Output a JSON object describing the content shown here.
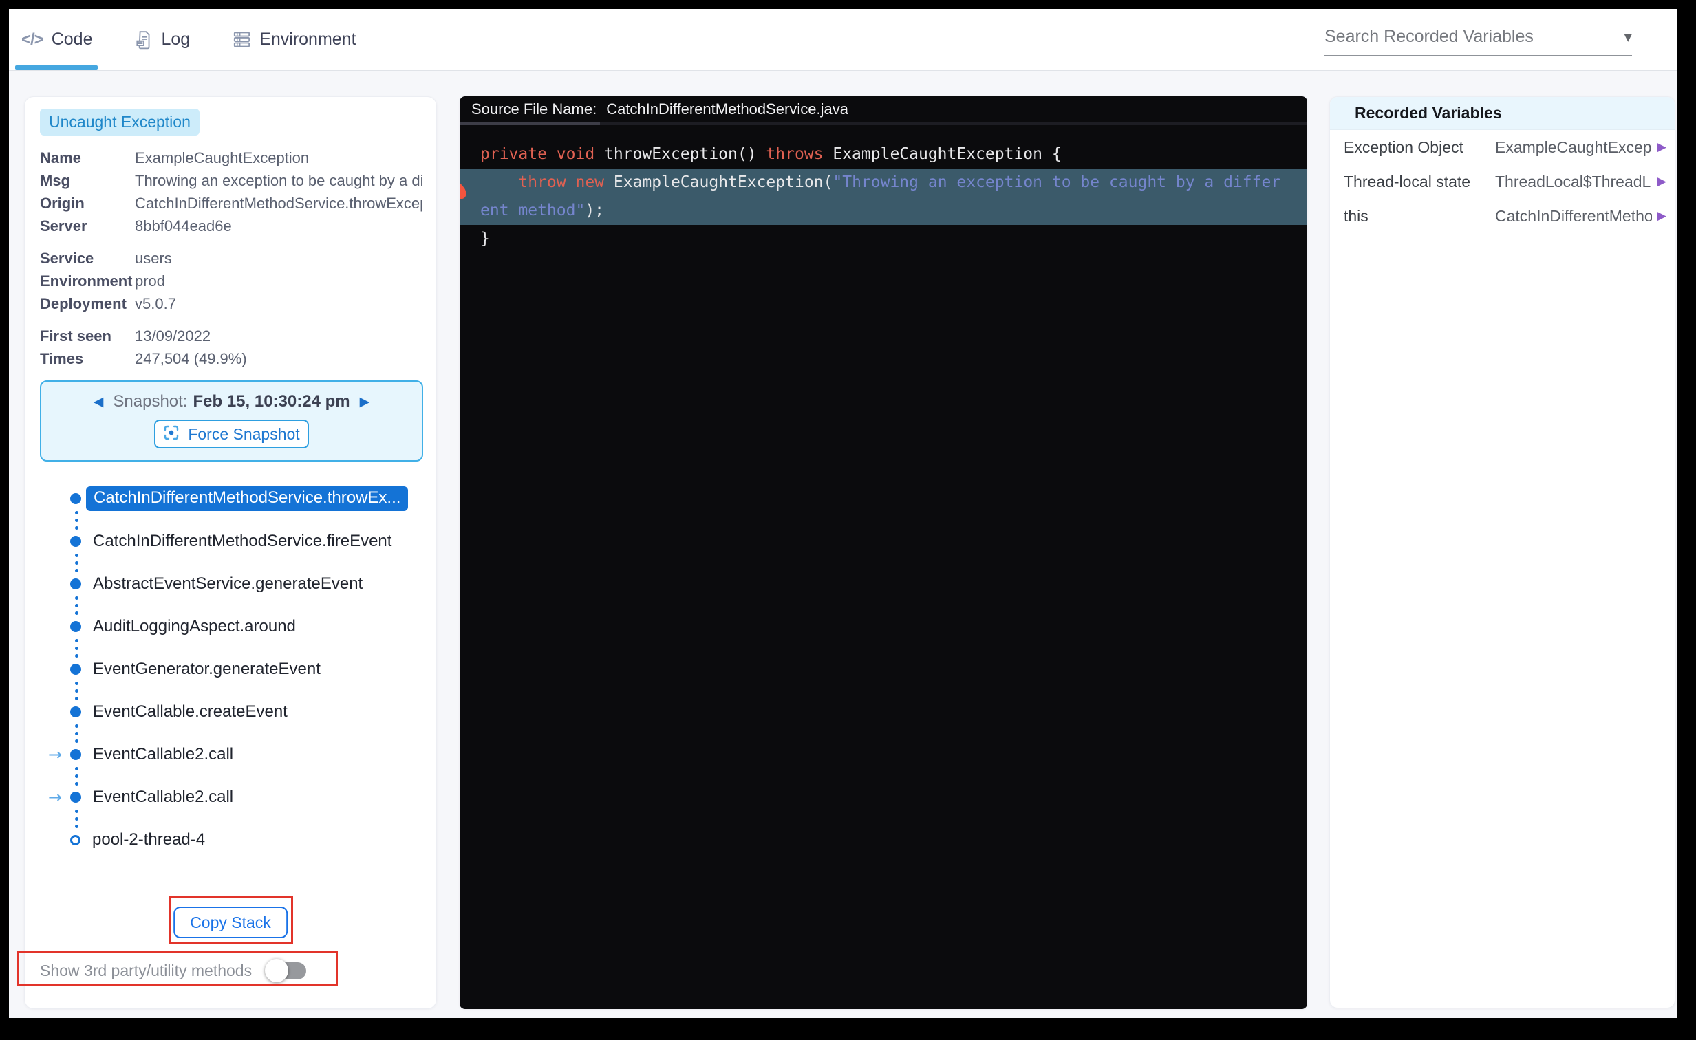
{
  "colors": {
    "accent_blue": "#1a73e8",
    "tab_underline": "#45a7e0",
    "badge_bg": "#cdecfa",
    "badge_text": "#1f87c9",
    "stack_dot": "#1473d6",
    "code_keyword": "#e06152",
    "code_string": "#7585cd",
    "code_highlight_bg": "#3b5a6a",
    "annotation_red": "#e2342a",
    "variable_expand_purple": "#8e5bc8"
  },
  "icons": {
    "code_tab": "</>",
    "prev": "◀",
    "next": "▶",
    "frame_arrow": "→",
    "caret": "▼",
    "expand": "▶"
  },
  "tabs": {
    "code": "Code",
    "log": "Log",
    "environment": "Environment",
    "active": "Code"
  },
  "search": {
    "label": "Search Recorded Variables"
  },
  "exception": {
    "badge": "Uncaught Exception",
    "group1": [
      {
        "label": "Name",
        "value": "ExampleCaughtException"
      },
      {
        "label": "Msg",
        "value": "Throwing an exception to be caught by a dif"
      },
      {
        "label": "Origin",
        "value": "CatchInDifferentMethodService.throwExcep"
      },
      {
        "label": "Server",
        "value": "8bbf044ead6e"
      }
    ],
    "group2": [
      {
        "label": "Service",
        "value": "users"
      },
      {
        "label": "Environment",
        "value": "prod"
      },
      {
        "label": "Deployment",
        "value": "v5.0.7"
      }
    ],
    "group3": [
      {
        "label": "First seen",
        "value": "13/09/2022"
      },
      {
        "label": "Times",
        "value": "247,504 (49.9%)"
      }
    ]
  },
  "snapshot": {
    "nav_label": "Snapshot:",
    "timestamp": "Feb 15, 10:30:24 pm",
    "force_button": "Force Snapshot"
  },
  "stack": {
    "frames": [
      {
        "label": "CatchInDifferentMethodService.throwEx..."
      },
      {
        "label": "CatchInDifferentMethodService.fireEvent"
      },
      {
        "label": "AbstractEventService.generateEvent"
      },
      {
        "label": "AuditLoggingAspect.around"
      },
      {
        "label": "EventGenerator.generateEvent"
      },
      {
        "label": "EventCallable.createEvent"
      },
      {
        "label": "EventCallable2.call"
      },
      {
        "label": "EventCallable2.call"
      },
      {
        "label": "pool-2-thread-4"
      }
    ],
    "copy_button": "Copy Stack",
    "toggle_label": "Show 3rd party/utility methods"
  },
  "code": {
    "header_label": "Source File Name:",
    "file_name": "CatchInDifferentMethodService.java",
    "line1": {
      "kw1": "private void ",
      "id1": "throwException() ",
      "kw2": "throws ",
      "id2": "ExampleCaughtException {"
    },
    "line2a": {
      "kw": "    throw new ",
      "id": "ExampleCaughtException(",
      "str": "\"Throwing an exception to be caught by a differ"
    },
    "line2b": {
      "str": "ent method\"",
      "plain": ");"
    },
    "line3": "}"
  },
  "recorded_variables": {
    "title": "Recorded Variables",
    "rows": [
      {
        "name": "Exception Object",
        "value": "ExampleCaughtExcept..."
      },
      {
        "name": "Thread-local state",
        "value": "ThreadLocal$ThreadL..."
      },
      {
        "name": "this",
        "value": "CatchInDifferentMetho..."
      }
    ]
  }
}
